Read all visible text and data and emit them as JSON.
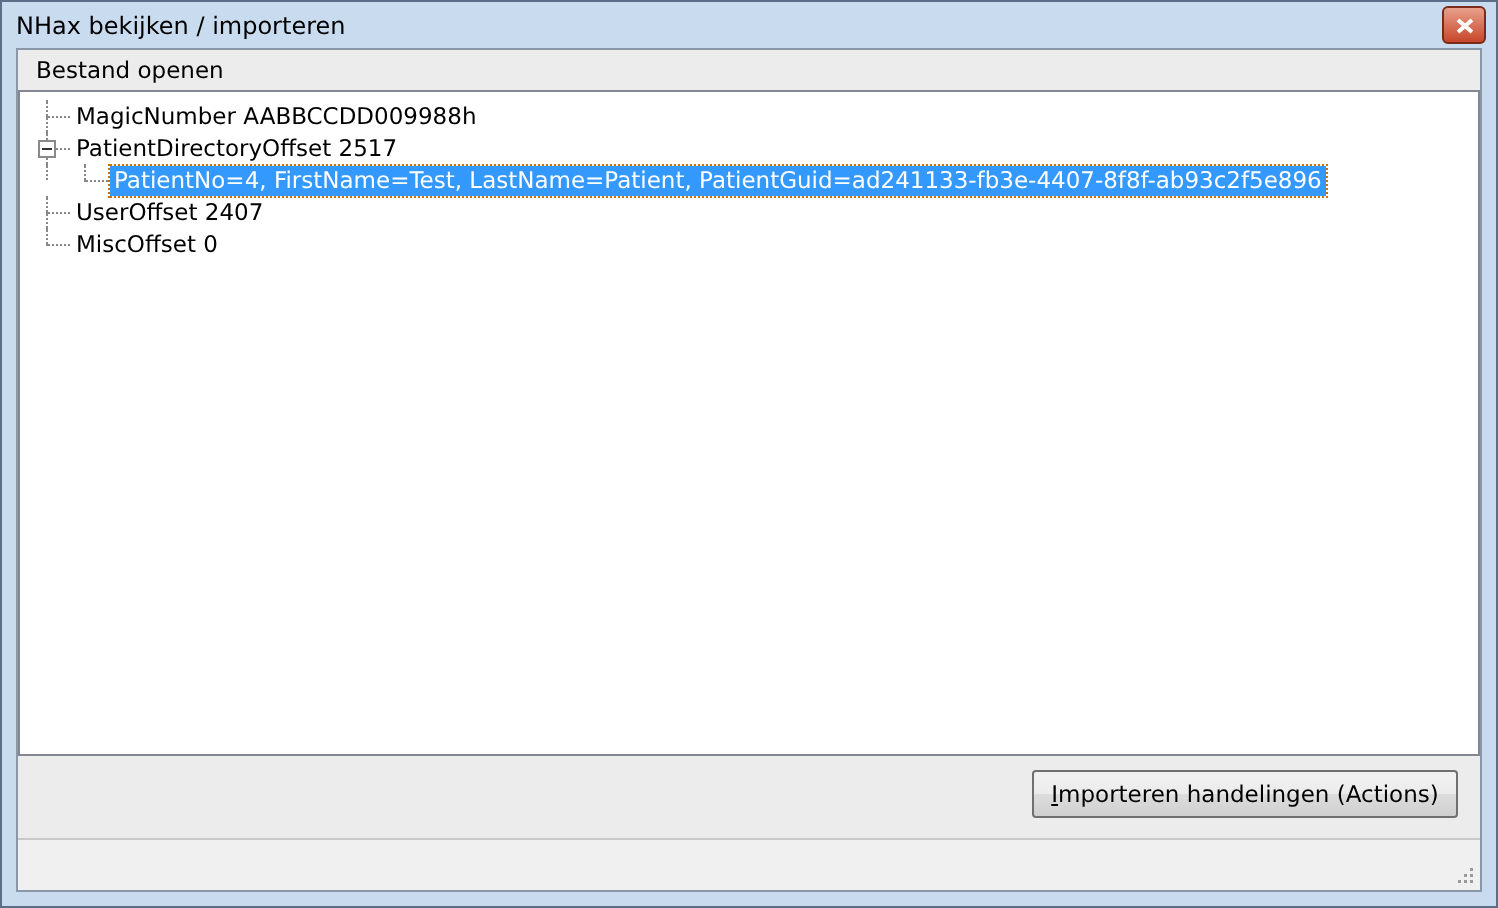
{
  "window": {
    "title": "NHax bekijken / importeren"
  },
  "menu": [
    "Bestand openen"
  ],
  "tree": [
    {
      "label": "MagicNumber AABBCCDD009988h",
      "selected": false
    },
    {
      "label": "PatientDirectoryOffset 2517",
      "selected": false,
      "expanded": true,
      "children": [
        {
          "label": "PatientNo=4, FirstName=Test, LastName=Patient, PatientGuid=ad241133-fb3e-4407-8f8f-ab93c2f5e896",
          "selected": true
        }
      ]
    },
    {
      "label": "UserOffset 2407",
      "selected": false
    },
    {
      "label": "MiscOffset 0",
      "selected": false
    }
  ],
  "buttons": [
    "Importeren handelingen (Actions)"
  ]
}
